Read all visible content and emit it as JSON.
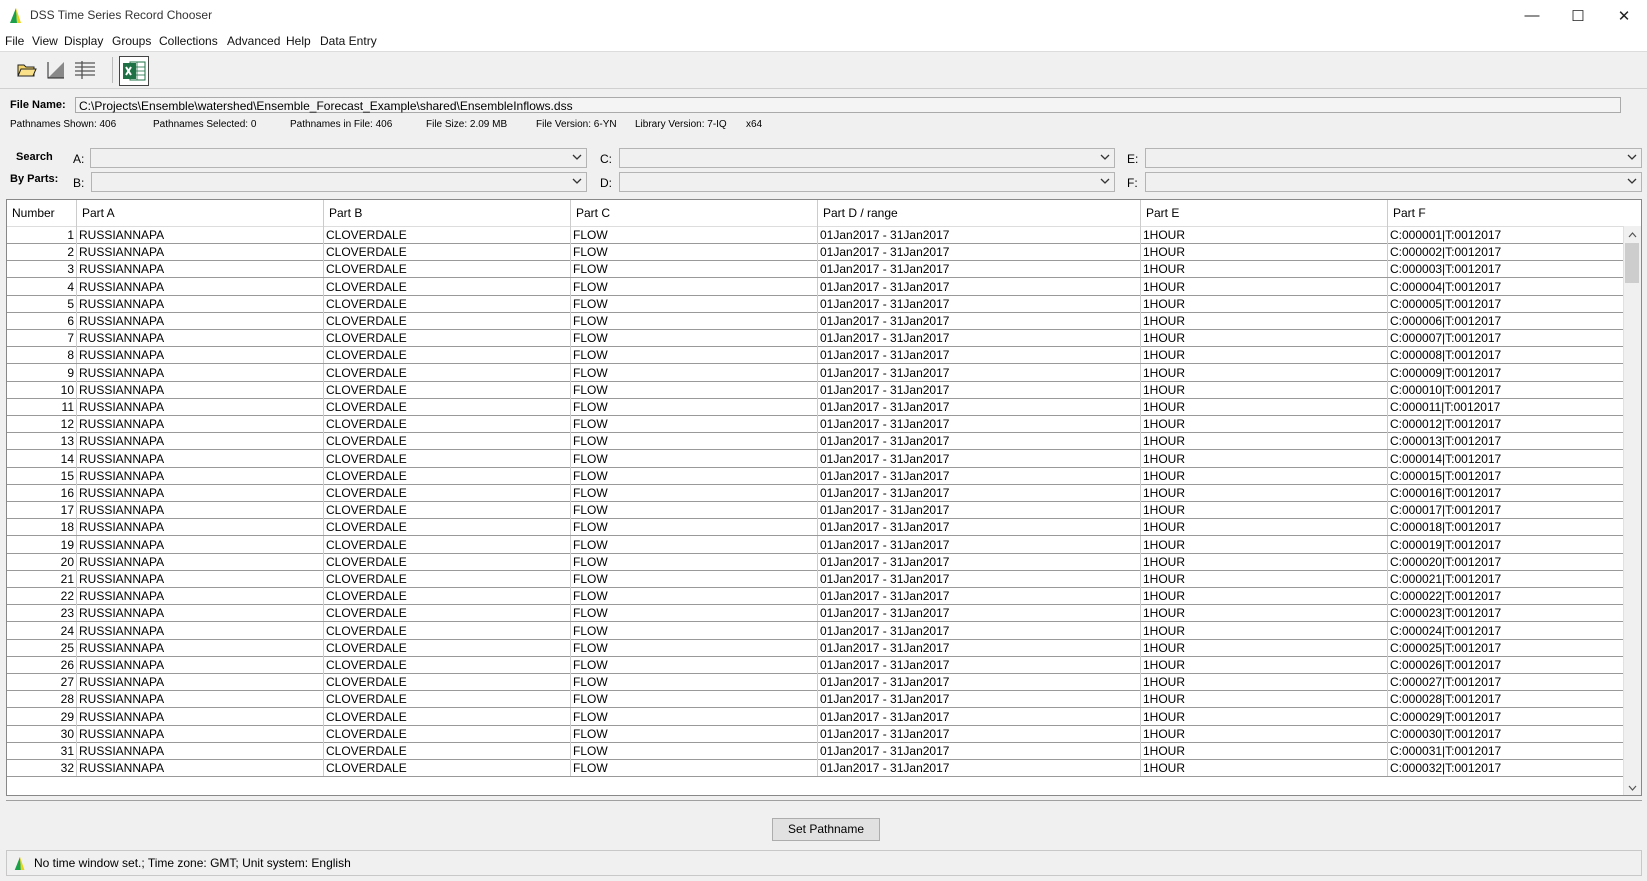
{
  "window": {
    "title": "DSS Time Series Record Chooser",
    "minimize": "—",
    "maximize": "☐",
    "close": "✕"
  },
  "menu": [
    "File",
    "View",
    "Display",
    "Groups",
    "Collections",
    "Advanced",
    "Help",
    "Data Entry"
  ],
  "toolbar": {
    "icons": [
      "open-folder-icon",
      "plot-icon",
      "table-icon",
      "excel-icon"
    ]
  },
  "file": {
    "label": "File Name:",
    "path": "C:\\Projects\\Ensemble\\watershed\\Ensemble_Forecast_Example\\shared\\EnsembleInflows.dss"
  },
  "stats": {
    "shown": "Pathnames Shown:  406",
    "selected": "Pathnames Selected: 0",
    "in_file": "Pathnames in File:  406",
    "size": "File Size:  2.09  MB",
    "file_version": "File Version: 6-YN",
    "library_version": "Library Version: 7-IQ",
    "arch": "x64"
  },
  "search": {
    "label1": "Search",
    "label2": "By Parts:",
    "parts": [
      "A:",
      "B:",
      "C:",
      "D:",
      "E:",
      "F:"
    ]
  },
  "table": {
    "columns": [
      "Number",
      "Part A",
      "Part B",
      "Part C",
      "Part D / range",
      "Part E",
      "Part F"
    ],
    "rows": [
      [
        "1",
        "RUSSIANNAPA",
        "CLOVERDALE",
        "FLOW",
        "01Jan2017 - 31Jan2017",
        "1HOUR",
        "C:000001|T:0012017"
      ],
      [
        "2",
        "RUSSIANNAPA",
        "CLOVERDALE",
        "FLOW",
        "01Jan2017 - 31Jan2017",
        "1HOUR",
        "C:000002|T:0012017"
      ],
      [
        "3",
        "RUSSIANNAPA",
        "CLOVERDALE",
        "FLOW",
        "01Jan2017 - 31Jan2017",
        "1HOUR",
        "C:000003|T:0012017"
      ],
      [
        "4",
        "RUSSIANNAPA",
        "CLOVERDALE",
        "FLOW",
        "01Jan2017 - 31Jan2017",
        "1HOUR",
        "C:000004|T:0012017"
      ],
      [
        "5",
        "RUSSIANNAPA",
        "CLOVERDALE",
        "FLOW",
        "01Jan2017 - 31Jan2017",
        "1HOUR",
        "C:000005|T:0012017"
      ],
      [
        "6",
        "RUSSIANNAPA",
        "CLOVERDALE",
        "FLOW",
        "01Jan2017 - 31Jan2017",
        "1HOUR",
        "C:000006|T:0012017"
      ],
      [
        "7",
        "RUSSIANNAPA",
        "CLOVERDALE",
        "FLOW",
        "01Jan2017 - 31Jan2017",
        "1HOUR",
        "C:000007|T:0012017"
      ],
      [
        "8",
        "RUSSIANNAPA",
        "CLOVERDALE",
        "FLOW",
        "01Jan2017 - 31Jan2017",
        "1HOUR",
        "C:000008|T:0012017"
      ],
      [
        "9",
        "RUSSIANNAPA",
        "CLOVERDALE",
        "FLOW",
        "01Jan2017 - 31Jan2017",
        "1HOUR",
        "C:000009|T:0012017"
      ],
      [
        "10",
        "RUSSIANNAPA",
        "CLOVERDALE",
        "FLOW",
        "01Jan2017 - 31Jan2017",
        "1HOUR",
        "C:000010|T:0012017"
      ],
      [
        "11",
        "RUSSIANNAPA",
        "CLOVERDALE",
        "FLOW",
        "01Jan2017 - 31Jan2017",
        "1HOUR",
        "C:000011|T:0012017"
      ],
      [
        "12",
        "RUSSIANNAPA",
        "CLOVERDALE",
        "FLOW",
        "01Jan2017 - 31Jan2017",
        "1HOUR",
        "C:000012|T:0012017"
      ],
      [
        "13",
        "RUSSIANNAPA",
        "CLOVERDALE",
        "FLOW",
        "01Jan2017 - 31Jan2017",
        "1HOUR",
        "C:000013|T:0012017"
      ],
      [
        "14",
        "RUSSIANNAPA",
        "CLOVERDALE",
        "FLOW",
        "01Jan2017 - 31Jan2017",
        "1HOUR",
        "C:000014|T:0012017"
      ],
      [
        "15",
        "RUSSIANNAPA",
        "CLOVERDALE",
        "FLOW",
        "01Jan2017 - 31Jan2017",
        "1HOUR",
        "C:000015|T:0012017"
      ],
      [
        "16",
        "RUSSIANNAPA",
        "CLOVERDALE",
        "FLOW",
        "01Jan2017 - 31Jan2017",
        "1HOUR",
        "C:000016|T:0012017"
      ],
      [
        "17",
        "RUSSIANNAPA",
        "CLOVERDALE",
        "FLOW",
        "01Jan2017 - 31Jan2017",
        "1HOUR",
        "C:000017|T:0012017"
      ],
      [
        "18",
        "RUSSIANNAPA",
        "CLOVERDALE",
        "FLOW",
        "01Jan2017 - 31Jan2017",
        "1HOUR",
        "C:000018|T:0012017"
      ],
      [
        "19",
        "RUSSIANNAPA",
        "CLOVERDALE",
        "FLOW",
        "01Jan2017 - 31Jan2017",
        "1HOUR",
        "C:000019|T:0012017"
      ],
      [
        "20",
        "RUSSIANNAPA",
        "CLOVERDALE",
        "FLOW",
        "01Jan2017 - 31Jan2017",
        "1HOUR",
        "C:000020|T:0012017"
      ],
      [
        "21",
        "RUSSIANNAPA",
        "CLOVERDALE",
        "FLOW",
        "01Jan2017 - 31Jan2017",
        "1HOUR",
        "C:000021|T:0012017"
      ],
      [
        "22",
        "RUSSIANNAPA",
        "CLOVERDALE",
        "FLOW",
        "01Jan2017 - 31Jan2017",
        "1HOUR",
        "C:000022|T:0012017"
      ],
      [
        "23",
        "RUSSIANNAPA",
        "CLOVERDALE",
        "FLOW",
        "01Jan2017 - 31Jan2017",
        "1HOUR",
        "C:000023|T:0012017"
      ],
      [
        "24",
        "RUSSIANNAPA",
        "CLOVERDALE",
        "FLOW",
        "01Jan2017 - 31Jan2017",
        "1HOUR",
        "C:000024|T:0012017"
      ],
      [
        "25",
        "RUSSIANNAPA",
        "CLOVERDALE",
        "FLOW",
        "01Jan2017 - 31Jan2017",
        "1HOUR",
        "C:000025|T:0012017"
      ],
      [
        "26",
        "RUSSIANNAPA",
        "CLOVERDALE",
        "FLOW",
        "01Jan2017 - 31Jan2017",
        "1HOUR",
        "C:000026|T:0012017"
      ],
      [
        "27",
        "RUSSIANNAPA",
        "CLOVERDALE",
        "FLOW",
        "01Jan2017 - 31Jan2017",
        "1HOUR",
        "C:000027|T:0012017"
      ],
      [
        "28",
        "RUSSIANNAPA",
        "CLOVERDALE",
        "FLOW",
        "01Jan2017 - 31Jan2017",
        "1HOUR",
        "C:000028|T:0012017"
      ],
      [
        "29",
        "RUSSIANNAPA",
        "CLOVERDALE",
        "FLOW",
        "01Jan2017 - 31Jan2017",
        "1HOUR",
        "C:000029|T:0012017"
      ],
      [
        "30",
        "RUSSIANNAPA",
        "CLOVERDALE",
        "FLOW",
        "01Jan2017 - 31Jan2017",
        "1HOUR",
        "C:000030|T:0012017"
      ],
      [
        "31",
        "RUSSIANNAPA",
        "CLOVERDALE",
        "FLOW",
        "01Jan2017 - 31Jan2017",
        "1HOUR",
        "C:000031|T:0012017"
      ],
      [
        "32",
        "RUSSIANNAPA",
        "CLOVERDALE",
        "FLOW",
        "01Jan2017 - 31Jan2017",
        "1HOUR",
        "C:000032|T:0012017"
      ]
    ]
  },
  "actions": {
    "set_pathname": "Set Pathname"
  },
  "status": {
    "text": "No time window set.;  Time zone: GMT;  Unit system: English"
  },
  "colors": {
    "logo_green": "#1aa04a",
    "logo_yellow": "#e8d21a",
    "excel_green": "#1e7145"
  }
}
